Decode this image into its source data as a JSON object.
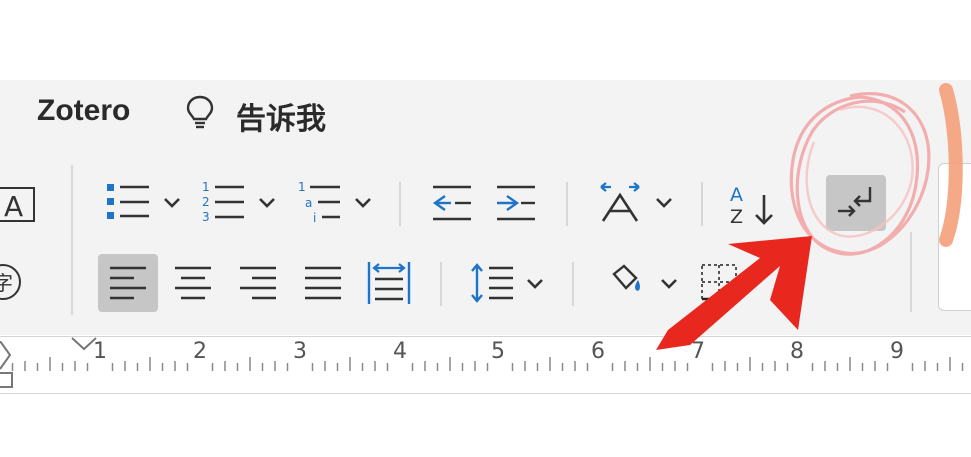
{
  "menu": {
    "zotero_label": "Zotero",
    "tell_me_label": "告诉我"
  },
  "toolbar": {
    "row1": [
      "bullet-list",
      "numbered-list",
      "multilevel-list",
      "decrease-indent",
      "increase-indent",
      "text-direction",
      "sort",
      "ltr-text-direction"
    ],
    "row2": [
      "align-left",
      "align-center",
      "align-right",
      "justify",
      "distributed",
      "line-spacing",
      "shading",
      "borders"
    ],
    "ltr_button_glyph": "→↵",
    "sort_glyph_top": "A",
    "sort_glyph_bottom": "Z"
  },
  "ruler": {
    "numbers": [
      "1",
      "2",
      "3",
      "4",
      "5",
      "6",
      "7",
      "8",
      "9"
    ]
  },
  "colors": {
    "accent_blue": "#1e74c6",
    "annotation_red": "#e8281e",
    "circle_pink": "#f2a6a6",
    "pressed_gray": "#c6c6c6"
  }
}
